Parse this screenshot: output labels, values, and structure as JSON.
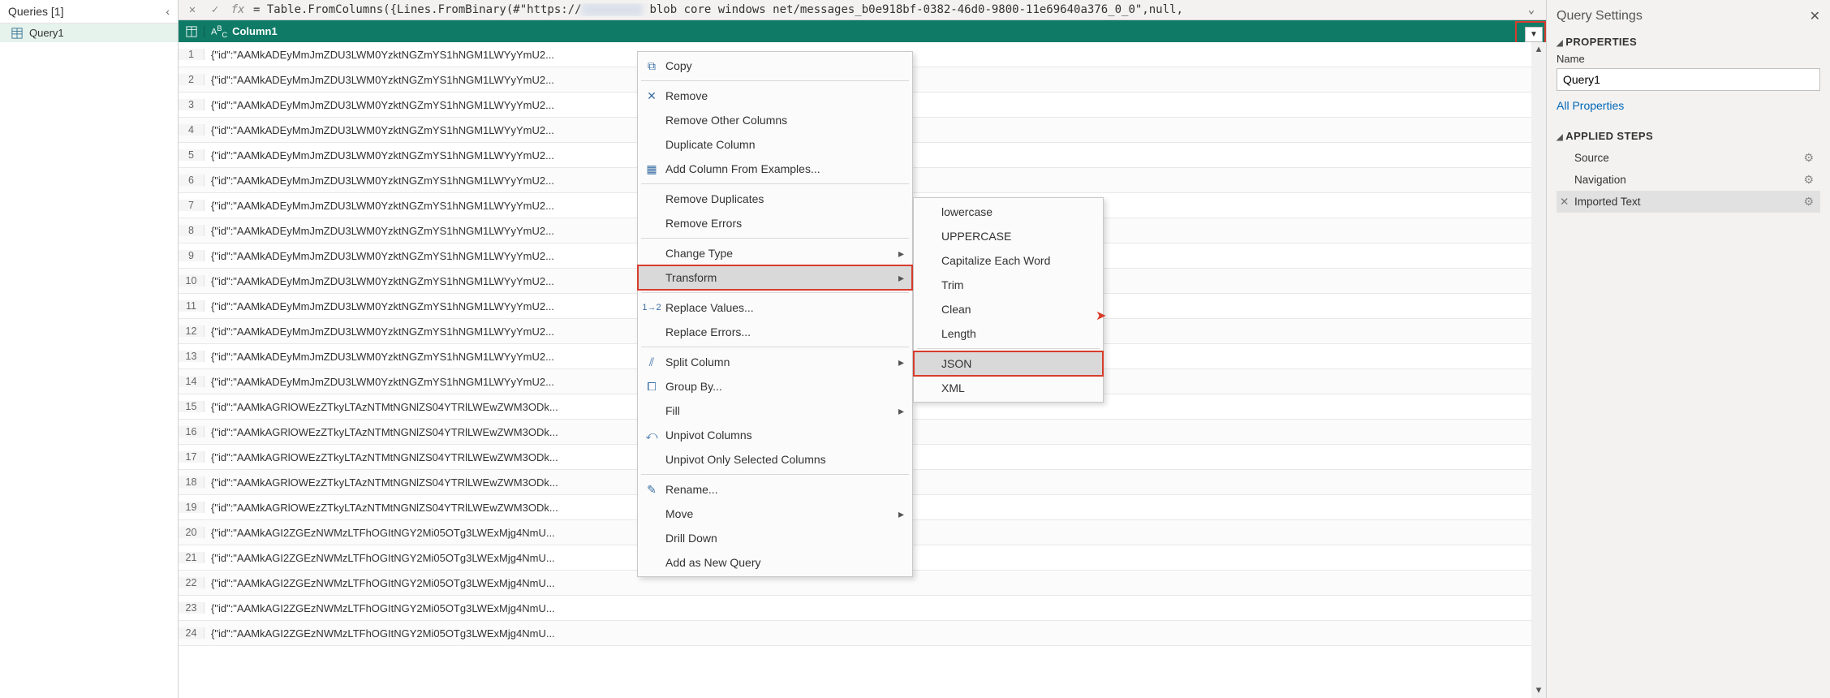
{
  "queries": {
    "header": "Queries [1]",
    "item": "Query1"
  },
  "formula": {
    "fx": "fx",
    "text_prefix": "= Table.FromColumns({Lines.FromBinary(#\"https://",
    "text_suffix": " blob core windows net/messages_b0e918bf-0382-46d0-9800-11e69640a376_0_0\",null,"
  },
  "column_header": "Column1",
  "rows": [
    "{\"id\":\"AAMkADEyMmJmZDU3LWM0YzktNGZmYS1hNGM1LWYyYmU2...",
    "{\"id\":\"AAMkADEyMmJmZDU3LWM0YzktNGZmYS1hNGM1LWYyYmU2...",
    "{\"id\":\"AAMkADEyMmJmZDU3LWM0YzktNGZmYS1hNGM1LWYyYmU2...",
    "{\"id\":\"AAMkADEyMmJmZDU3LWM0YzktNGZmYS1hNGM1LWYyYmU2...",
    "{\"id\":\"AAMkADEyMmJmZDU3LWM0YzktNGZmYS1hNGM1LWYyYmU2...",
    "{\"id\":\"AAMkADEyMmJmZDU3LWM0YzktNGZmYS1hNGM1LWYyYmU2...",
    "{\"id\":\"AAMkADEyMmJmZDU3LWM0YzktNGZmYS1hNGM1LWYyYmU2...",
    "{\"id\":\"AAMkADEyMmJmZDU3LWM0YzktNGZmYS1hNGM1LWYyYmU2...",
    "{\"id\":\"AAMkADEyMmJmZDU3LWM0YzktNGZmYS1hNGM1LWYyYmU2...",
    "{\"id\":\"AAMkADEyMmJmZDU3LWM0YzktNGZmYS1hNGM1LWYyYmU2...",
    "{\"id\":\"AAMkADEyMmJmZDU3LWM0YzktNGZmYS1hNGM1LWYyYmU2...",
    "{\"id\":\"AAMkADEyMmJmZDU3LWM0YzktNGZmYS1hNGM1LWYyYmU2...",
    "{\"id\":\"AAMkADEyMmJmZDU3LWM0YzktNGZmYS1hNGM1LWYyYmU2...",
    "{\"id\":\"AAMkADEyMmJmZDU3LWM0YzktNGZmYS1hNGM1LWYyYmU2...",
    "{\"id\":\"AAMkAGRlOWEzZTkyLTAzNTMtNGNlZS04YTRlLWEwZWM3ODk...",
    "{\"id\":\"AAMkAGRlOWEzZTkyLTAzNTMtNGNlZS04YTRlLWEwZWM3ODk...",
    "{\"id\":\"AAMkAGRlOWEzZTkyLTAzNTMtNGNlZS04YTRlLWEwZWM3ODk...",
    "{\"id\":\"AAMkAGRlOWEzZTkyLTAzNTMtNGNlZS04YTRlLWEwZWM3ODk...",
    "{\"id\":\"AAMkAGRlOWEzZTkyLTAzNTMtNGNlZS04YTRlLWEwZWM3ODk...",
    "{\"id\":\"AAMkAGI2ZGEzNWMzLTFhOGItNGY2Mi05OTg3LWExMjg4NmU...",
    "{\"id\":\"AAMkAGI2ZGEzNWMzLTFhOGItNGY2Mi05OTg3LWExMjg4NmU...",
    "{\"id\":\"AAMkAGI2ZGEzNWMzLTFhOGItNGY2Mi05OTg3LWExMjg4NmU...",
    "{\"id\":\"AAMkAGI2ZGEzNWMzLTFhOGItNGY2Mi05OTg3LWExMjg4NmU...",
    "{\"id\":\"AAMkAGI2ZGEzNWMzLTFhOGItNGY2Mi05OTg3LWExMjg4NmU..."
  ],
  "ctx": {
    "copy": "Copy",
    "remove": "Remove",
    "remove_other": "Remove Other Columns",
    "dup": "Duplicate Column",
    "add_example": "Add Column From Examples...",
    "remove_dup": "Remove Duplicates",
    "remove_err": "Remove Errors",
    "change_type": "Change Type",
    "transform": "Transform",
    "replace_values": "Replace Values...",
    "replace_errors": "Replace Errors...",
    "split": "Split Column",
    "group": "Group By...",
    "fill": "Fill",
    "unpivot": "Unpivot Columns",
    "unpivot_sel": "Unpivot Only Selected Columns",
    "rename": "Rename...",
    "move": "Move",
    "drill": "Drill Down",
    "add_query": "Add as New Query"
  },
  "sub": {
    "lower": "lowercase",
    "upper": "UPPERCASE",
    "cap": "Capitalize Each Word",
    "trim": "Trim",
    "clean": "Clean",
    "length": "Length",
    "json": "JSON",
    "xml": "XML"
  },
  "settings": {
    "title": "Query Settings",
    "properties": "PROPERTIES",
    "name_label": "Name",
    "name_value": "Query1",
    "all_props": "All Properties",
    "applied": "APPLIED STEPS",
    "steps": [
      "Source",
      "Navigation",
      "Imported Text"
    ]
  }
}
